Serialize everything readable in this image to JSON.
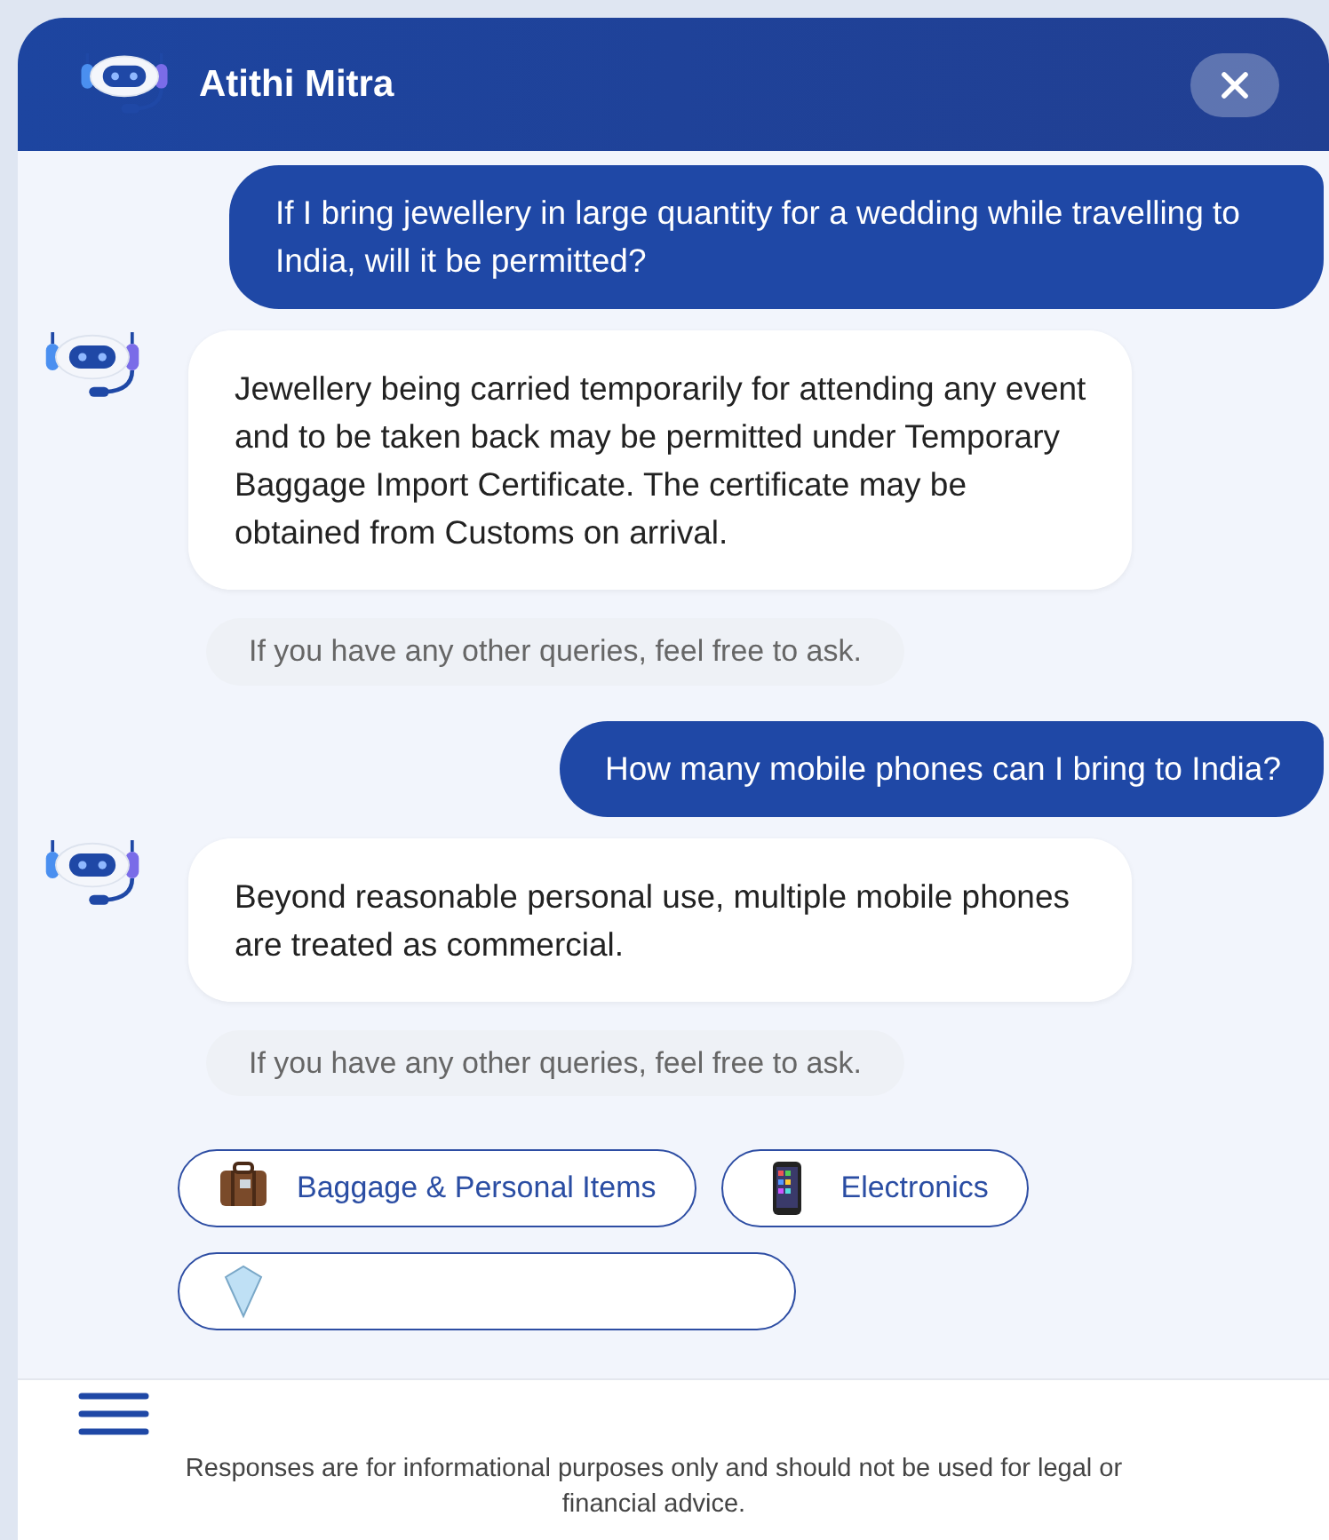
{
  "header": {
    "title": "Atithi Mitra"
  },
  "messages": [
    {
      "kind": "user",
      "text": "If I bring jewellery in large quantity for a wedding while travelling to India, will it be permitted?"
    },
    {
      "kind": "bot",
      "text": "Jewellery being carried temporarily for attending any event and to be taken back may be permitted under Temporary Baggage Import Certificate. The certificate may be obtained from Customs on arrival."
    },
    {
      "kind": "note",
      "text": "If you have any other queries, feel free to ask."
    },
    {
      "kind": "user",
      "text": "How many mobile phones can I bring to India?"
    },
    {
      "kind": "bot",
      "text": "Beyond reasonable personal use, multiple mobile phones are treated as commercial."
    },
    {
      "kind": "note",
      "text": "If you have any other queries, feel free to ask."
    }
  ],
  "chips": [
    {
      "kind": "baggage",
      "label": "Baggage & Personal Items"
    },
    {
      "kind": "electronics",
      "label": "Electronics"
    },
    {
      "kind": "valuables"
    }
  ],
  "footer": {
    "disclaimer": "Responses are for informational purposes only and should not be used for legal or financial advice."
  }
}
